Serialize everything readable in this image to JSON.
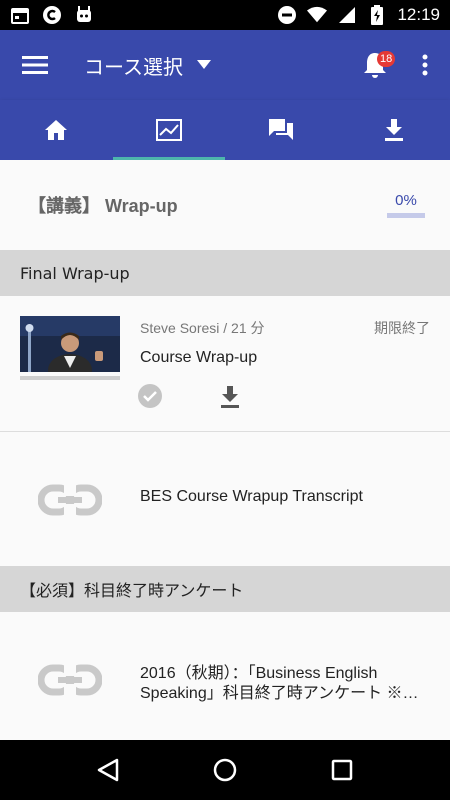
{
  "status_bar": {
    "time": "12:19"
  },
  "app_bar": {
    "title": "コース選択",
    "notification_count": "18"
  },
  "tabs": [
    {
      "icon": "home-icon",
      "active": false
    },
    {
      "icon": "chart-icon",
      "active": true
    },
    {
      "icon": "forum-icon",
      "active": false
    },
    {
      "icon": "download-icon",
      "active": false
    }
  ],
  "lecture": {
    "title": "【講義】 Wrap-up",
    "progress_text": "0%",
    "progress": 0
  },
  "sections": [
    {
      "title": "Final Wrap-up"
    },
    {
      "title": "【必須】科目終了時アンケート"
    }
  ],
  "video_item": {
    "meta": "Steve Soresi / 21 分",
    "status": "期限終了",
    "title": "Course Wrap-up"
  },
  "link_item": {
    "title": "BES Course Wrapup Transcript"
  },
  "survey_item": {
    "title": "2016（秋期）：「Business English Speaking」科目終了時アンケート ※…"
  },
  "colors": {
    "primary": "#3949ab",
    "tab_indicator": "#4db6ac",
    "badge": "#e53935"
  }
}
